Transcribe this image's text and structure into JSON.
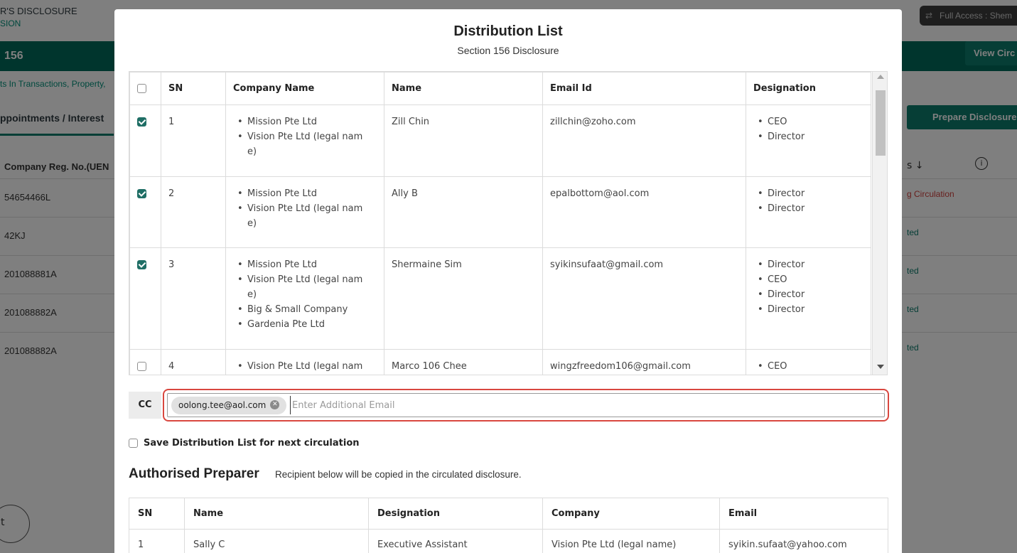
{
  "background": {
    "header_title": "R'S DISCLOSURE",
    "header_sub": "SION",
    "access_label": "Full Access : Shem",
    "section_number": "156",
    "view_button": "View Circ",
    "description": "ts In Transactions, Property,",
    "tab_label": "ppointments / Interest",
    "prepare_button": "Prepare Disclosure",
    "uen_header": "Company Reg. No.(UEN",
    "sort_label": "s ↓",
    "rows": [
      {
        "uen": "54654466L",
        "status": "g Circulation"
      },
      {
        "uen": "42KJ",
        "status": "ted"
      },
      {
        "uen": "201088881A",
        "status": "ted"
      },
      {
        "uen": "201088882A",
        "status": "ted"
      },
      {
        "uen": "201088882A",
        "status": "ted"
      }
    ],
    "bottom_circle_text": "t"
  },
  "modal": {
    "title": "Distribution List",
    "subtitle": "Section 156 Disclosure",
    "distribution_table": {
      "headers": [
        "SN",
        "Company Name",
        "Name",
        "Email Id",
        "Designation"
      ],
      "rows": [
        {
          "checked": true,
          "sn": "1",
          "companies": [
            "Mission Pte Ltd",
            "Vision Pte Ltd (legal nam",
            "e)"
          ],
          "name": "Zill Chin",
          "email": "zillchin@zoho.com",
          "designations": [
            "CEO",
            "Director"
          ]
        },
        {
          "checked": true,
          "sn": "2",
          "companies": [
            "Mission Pte Ltd",
            "Vision Pte Ltd (legal nam",
            "e)"
          ],
          "name": "Ally B",
          "email": "epalbottom@aol.com",
          "designations": [
            "Director",
            "Director"
          ]
        },
        {
          "checked": true,
          "sn": "3",
          "companies": [
            "Mission Pte Ltd",
            "Vision Pte Ltd (legal nam",
            "e)",
            "Big & Small Company",
            "Gardenia Pte Ltd"
          ],
          "name": "Shermaine Sim",
          "email": "syikinsufaat@gmail.com",
          "designations": [
            "Director",
            "CEO",
            "Director",
            "Director"
          ]
        },
        {
          "checked": false,
          "sn": "4",
          "companies": [
            "Vision Pte Ltd (legal nam"
          ],
          "name": "Marco 106 Chee",
          "email": "wingzfreedom106@gmail.com",
          "designations": [
            "CEO"
          ]
        }
      ]
    },
    "cc": {
      "label": "CC",
      "chips": [
        "oolong.tee@aol.com"
      ],
      "placeholder": "Enter Additional Email",
      "value": ""
    },
    "save_label": "Save Distribution List for next circulation",
    "save_checked": false,
    "authorised_preparer": {
      "title": "Authorised Preparer",
      "note": "Recipient below will be copied in the circulated disclosure.",
      "headers": [
        "SN",
        "Name",
        "Designation",
        "Company",
        "Email"
      ],
      "rows": [
        {
          "sn": "1",
          "name": "Sally C",
          "designation": "Executive Assistant",
          "company": "Vision Pte Ltd (legal name)",
          "email": "syikin.sufaat@yahoo.com"
        }
      ]
    }
  },
  "colors": {
    "accent": "#0c7c6c",
    "checkbox_checked": "#1f6e65",
    "highlight_border": "#d9473f",
    "overlay": "rgba(0,0,0,0.5)"
  }
}
